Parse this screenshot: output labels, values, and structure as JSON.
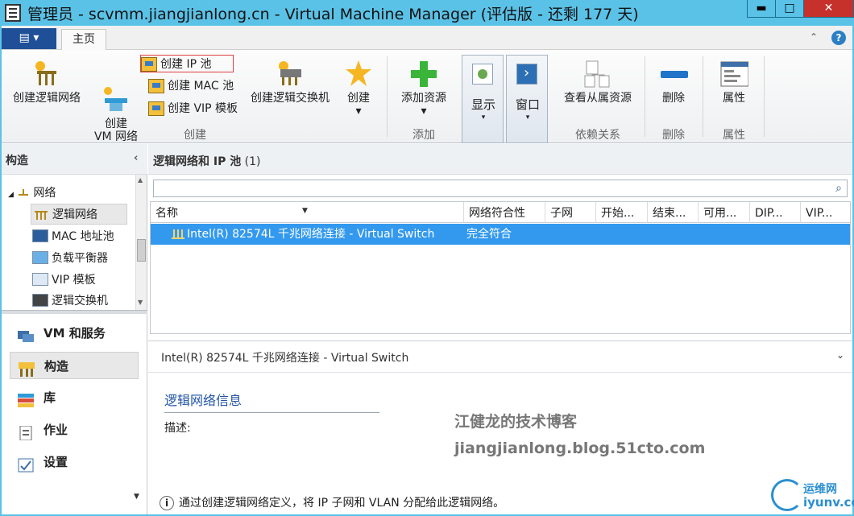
{
  "window": {
    "title": "管理员 - scvmm.jiangjianlong.cn - Virtual Machine Manager (评估版 - 还剩 177 天)",
    "min": "▬",
    "max": "□",
    "close": "✕"
  },
  "tabs": {
    "app_menu": "▤ ▾",
    "home": "主页",
    "collapse": "⌃",
    "help": "?"
  },
  "ribbon": {
    "create_logical_network": "创建逻辑网络",
    "create_vm_network": "创建\nVM 网络",
    "create_ip_pool": "创建 IP 池",
    "create_mac_pool": "创建 MAC 池",
    "create_vip_template": "创建 VIP 模板",
    "create_logical_switch": "创建逻辑交换机",
    "create": "创建",
    "add_resources": "添加资源",
    "show": "显示",
    "window": "窗口",
    "view_dependent": "查看从属资源",
    "delete": "删除",
    "properties": "属性",
    "groups": {
      "create": "创建",
      "add": "添加",
      "dependencies": "依赖关系",
      "delete": "删除",
      "properties": "属性"
    },
    "dropdown": "▾"
  },
  "left_pane": {
    "header": "构造",
    "collapse": "‹",
    "tree": [
      {
        "label": "网络"
      },
      {
        "label": "逻辑网络"
      },
      {
        "label": "MAC 地址池"
      },
      {
        "label": "负载平衡器"
      },
      {
        "label": "VIP 模板"
      },
      {
        "label": "逻辑交换机"
      }
    ],
    "workspaces": [
      {
        "label": "VM 和服务"
      },
      {
        "label": "构造"
      },
      {
        "label": "库"
      },
      {
        "label": "作业"
      },
      {
        "label": "设置"
      }
    ]
  },
  "center": {
    "header_bold": "逻辑网络和 IP 池",
    "header_count": " (1)",
    "search_placeholder": "",
    "columns": [
      "名称",
      "网络符合性",
      "子网",
      "开始...",
      "结束...",
      "可用...",
      "DIP...",
      "VIP..."
    ],
    "rows": [
      {
        "name": "Intel(R) 82574L 千兆网络连接 - Virtual Switch",
        "compliance": "完全符合"
      }
    ],
    "detail_title": "Intel(R) 82574L 千兆网络连接 - Virtual Switch",
    "section_title": "逻辑网络信息",
    "desc_label": "描述:",
    "info_text": "通过创建逻辑网络定义，将 IP 子网和 VLAN 分配给此逻辑网络。"
  },
  "watermark": {
    "line1": "江健龙的技术博客",
    "line2": "jiangjianlong.blog.51cto.com"
  },
  "logo": {
    "line1": "运维网",
    "line2": "iyunv.com"
  },
  "colors": {
    "accent": "#5bc2e7",
    "selection": "#3399ee",
    "link_title": "#2255a4"
  }
}
